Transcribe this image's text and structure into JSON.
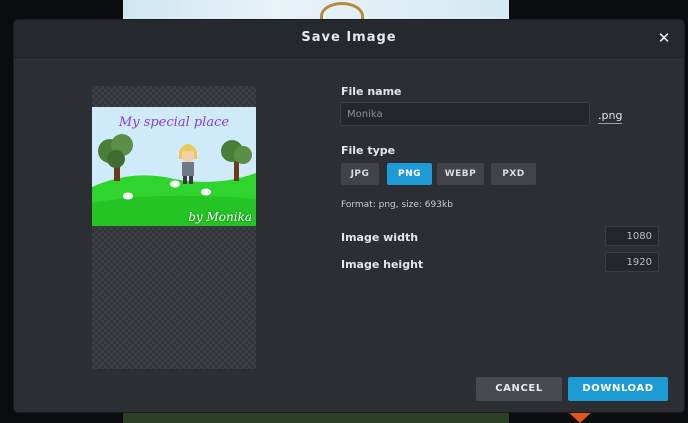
{
  "dialog": {
    "title": "Save Image",
    "close_glyph": "✕"
  },
  "preview": {
    "image_title": "My special place",
    "image_byline": "by Monika"
  },
  "form": {
    "filename_label": "File name",
    "filename_value": "Monika",
    "extension": ".png",
    "filetype_label": "File type",
    "filetypes": [
      "JPG",
      "PNG",
      "WEBP",
      "PXD"
    ],
    "selected_filetype": "PNG",
    "format_info": "Format: png, size: 693kb",
    "width_label": "Image width",
    "width_value": "1080",
    "height_label": "Image height",
    "height_value": "1920"
  },
  "actions": {
    "cancel_label": "CANCEL",
    "download_label": "DOWNLOAD"
  },
  "colors": {
    "accent": "#1c9bd4",
    "panel": "#2b2e33",
    "header": "#25282c"
  }
}
